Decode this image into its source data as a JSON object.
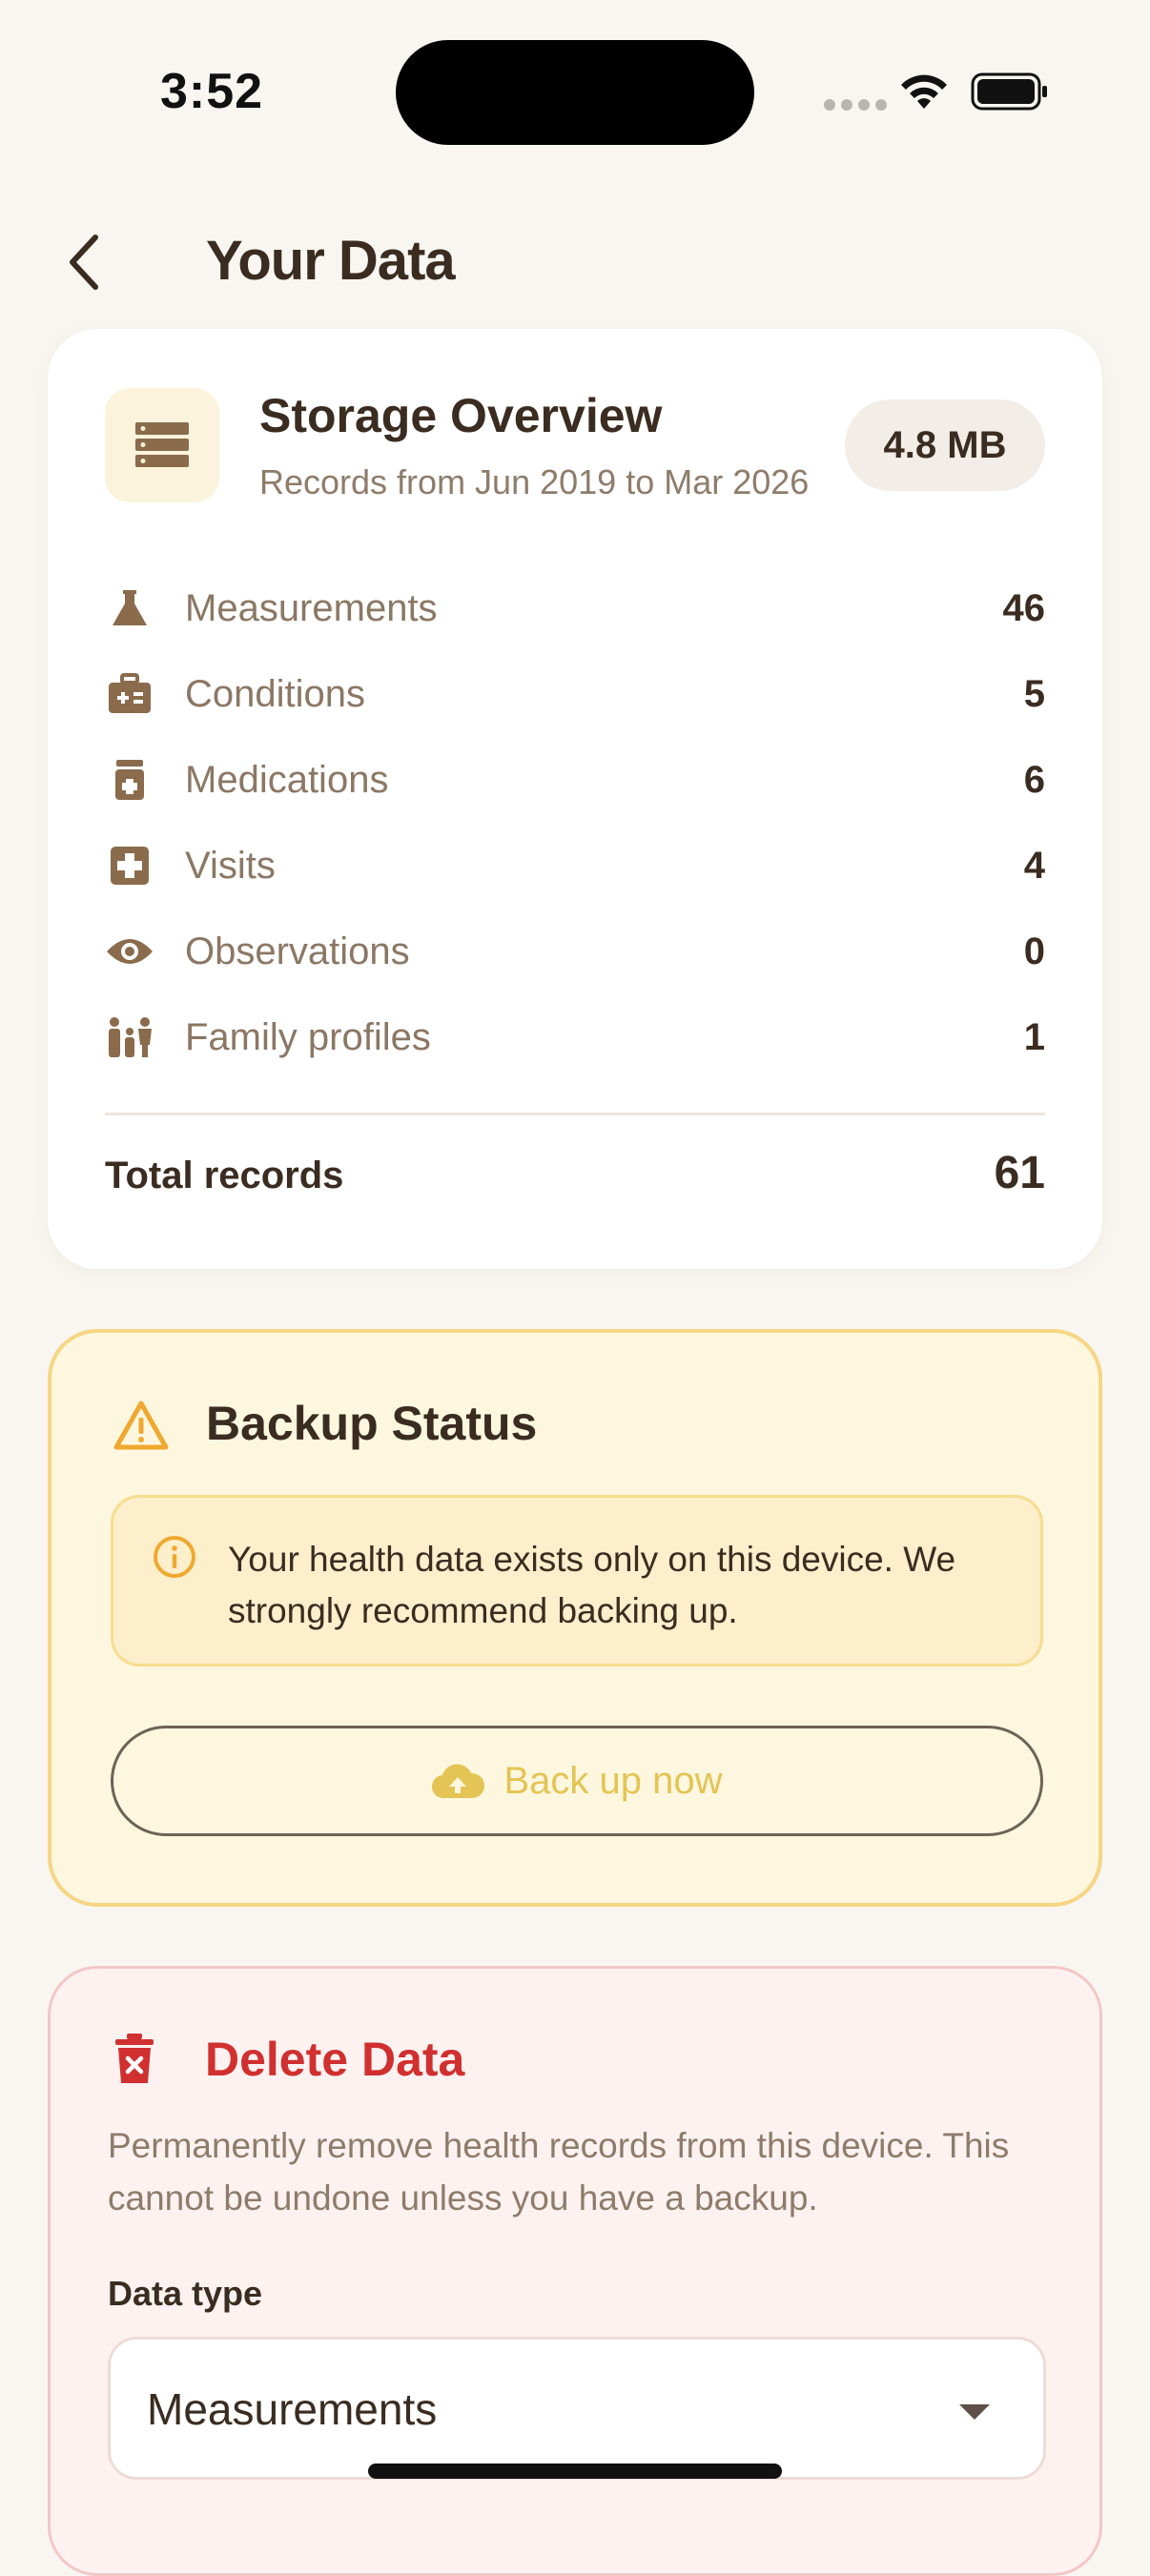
{
  "status": {
    "time": "3:52"
  },
  "nav": {
    "title": "Your Data"
  },
  "storage": {
    "title": "Storage Overview",
    "subtitle": "Records from Jun 2019 to Mar 2026",
    "size": "4.8 MB",
    "rows": [
      {
        "label": "Measurements",
        "count": "46",
        "icon": "flask-icon"
      },
      {
        "label": "Conditions",
        "count": "5",
        "icon": "medical-kit-icon"
      },
      {
        "label": "Medications",
        "count": "6",
        "icon": "pill-bottle-icon"
      },
      {
        "label": "Visits",
        "count": "4",
        "icon": "medical-cross-icon"
      },
      {
        "label": "Observations",
        "count": "0",
        "icon": "eye-icon"
      },
      {
        "label": "Family profiles",
        "count": "1",
        "icon": "family-icon"
      }
    ],
    "total_label": "Total records",
    "total_value": "61"
  },
  "backup": {
    "title": "Backup Status",
    "info": "Your health data exists only on this device. We strongly recommend backing up.",
    "button_label": "Back up now"
  },
  "delete": {
    "title": "Delete Data",
    "description": "Permanently remove health records from this device. This cannot be undone unless you have a backup.",
    "field_label": "Data type",
    "selected": "Measurements"
  },
  "colors": {
    "background": "#f9f6f1",
    "primary_text": "#3a2c20",
    "icon_brown": "#8a6b4c",
    "warning": "#f0a830",
    "danger": "#d0302f",
    "backup_button_text": "#e4c454"
  }
}
